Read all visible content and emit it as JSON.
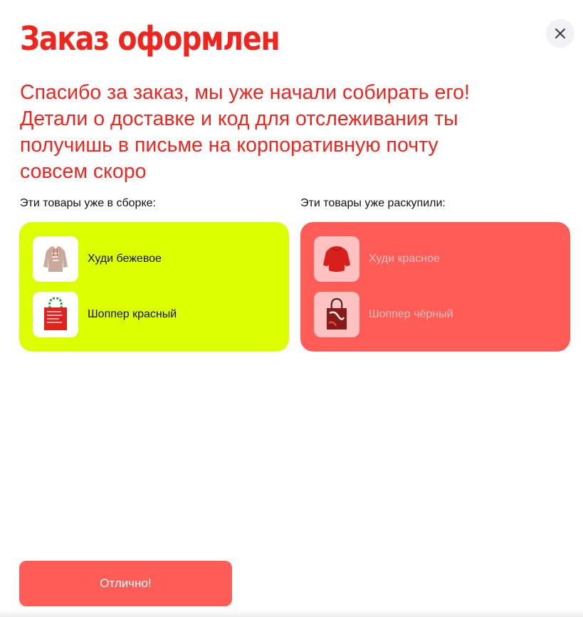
{
  "dialog": {
    "title": "Заказ оформлен",
    "message": "Спасибо за заказ, мы уже начали собирать его! Детали о доставке и код для отслеживания ты получишь в письме на корпоративную почту совсем скоро",
    "close_icon": "close-icon",
    "confirm_label": "Отлично!"
  },
  "in_assembly": {
    "label": "Эти товары уже в сборке:",
    "items": [
      {
        "name": "Худи бежевое",
        "icon": "hoodie-icon"
      },
      {
        "name": "Шоппер красный",
        "icon": "tote-bag-icon"
      }
    ]
  },
  "sold_out": {
    "label": "Эти товары уже раскупили:",
    "items": [
      {
        "name": "Худи красное",
        "icon": "hoodie-icon"
      },
      {
        "name": "Шоппер чёрный",
        "icon": "tote-bag-icon"
      }
    ]
  },
  "colors": {
    "accent_red": "#f0251e",
    "button_red": "#ff5c58",
    "in_assembly_panel": "#dbff00",
    "sold_out_panel": "#ff5c58"
  }
}
